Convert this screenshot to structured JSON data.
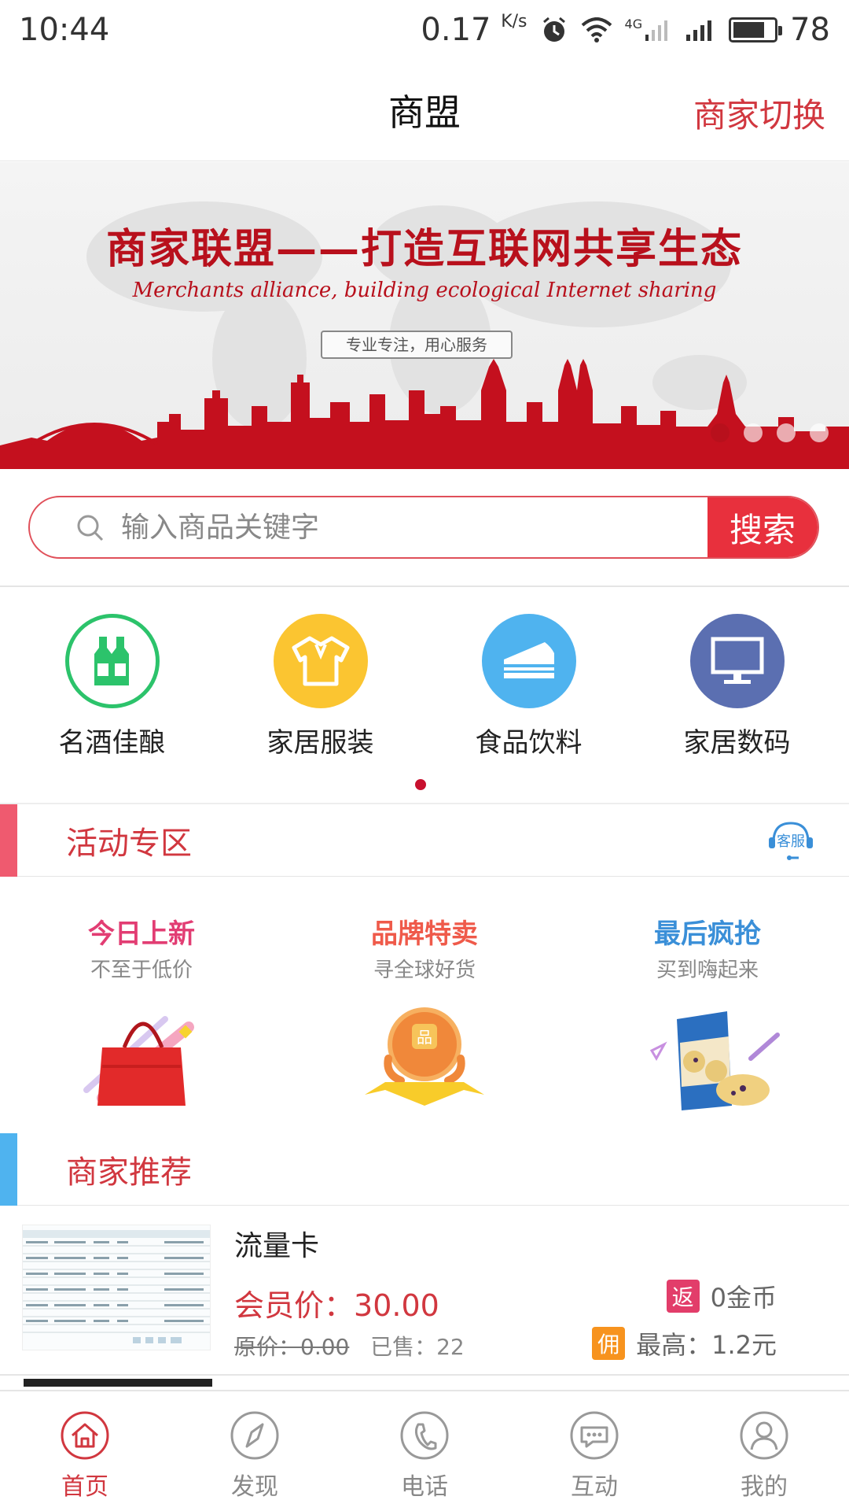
{
  "status_bar": {
    "time": "10:44",
    "speed": "0.17",
    "speed_unit": "K/s",
    "network": "4G",
    "battery": "78",
    "battery_level": 0.78
  },
  "header": {
    "title": "商盟",
    "switch_label": "商家切换"
  },
  "banner": {
    "title": "商家联盟——打造互联网共享生态",
    "subtitle": "Merchants alliance, building ecological Internet sharing",
    "tag": "专业专注，用心服务",
    "slide_count": 4,
    "active_slide": 0
  },
  "search": {
    "placeholder": "输入商品关键字",
    "button_label": "搜索"
  },
  "categories": [
    {
      "label": "名酒佳酿",
      "icon": "wine-bottles-icon",
      "color": "#2cc36b"
    },
    {
      "label": "家居服装",
      "icon": "shirt-icon",
      "color": "#fbc531"
    },
    {
      "label": "食品饮料",
      "icon": "cake-icon",
      "color": "#4fb3ef"
    },
    {
      "label": "家居数码",
      "icon": "monitor-icon",
      "color": "#5b6fb1"
    }
  ],
  "activities_section": {
    "title": "活动专区",
    "bar_color": "#ef5a6f",
    "service_label": "客服"
  },
  "activities": [
    {
      "title": "今日上新",
      "subtitle": "不至于低价",
      "color": "#e23d73",
      "image": "red-handbag-icon"
    },
    {
      "title": "品牌特卖",
      "subtitle": "寻全球好货",
      "color": "#ef5a4a",
      "image": "brand-globe-icon"
    },
    {
      "title": "最后疯抢",
      "subtitle": "买到嗨起来",
      "color": "#3a8fd8",
      "image": "blueberry-cookies-icon"
    }
  ],
  "merchant_section": {
    "title": "商家推荐",
    "bar_color": "#4fb3ef"
  },
  "merchant": {
    "name": "流量卡",
    "member_price_label": "会员价：",
    "member_price": "30.00",
    "original_price_label": "原价：",
    "original_price": "0.00",
    "sold_label": "已售：",
    "sold": "22",
    "rebate_tag": "返",
    "rebate_text": "0金币",
    "commission_tag": "佣",
    "commission_text": "最高：1.2元"
  },
  "tabbar": [
    {
      "label": "首页",
      "icon": "home-icon",
      "active": true
    },
    {
      "label": "发现",
      "icon": "compass-icon",
      "active": false
    },
    {
      "label": "电话",
      "icon": "phone-icon",
      "active": false
    },
    {
      "label": "互动",
      "icon": "chat-icon",
      "active": false
    },
    {
      "label": "我的",
      "icon": "user-icon",
      "active": false
    }
  ],
  "colors": {
    "accent": "#d1373f",
    "search_button": "#e8303d",
    "banner_red": "#b8101c"
  }
}
